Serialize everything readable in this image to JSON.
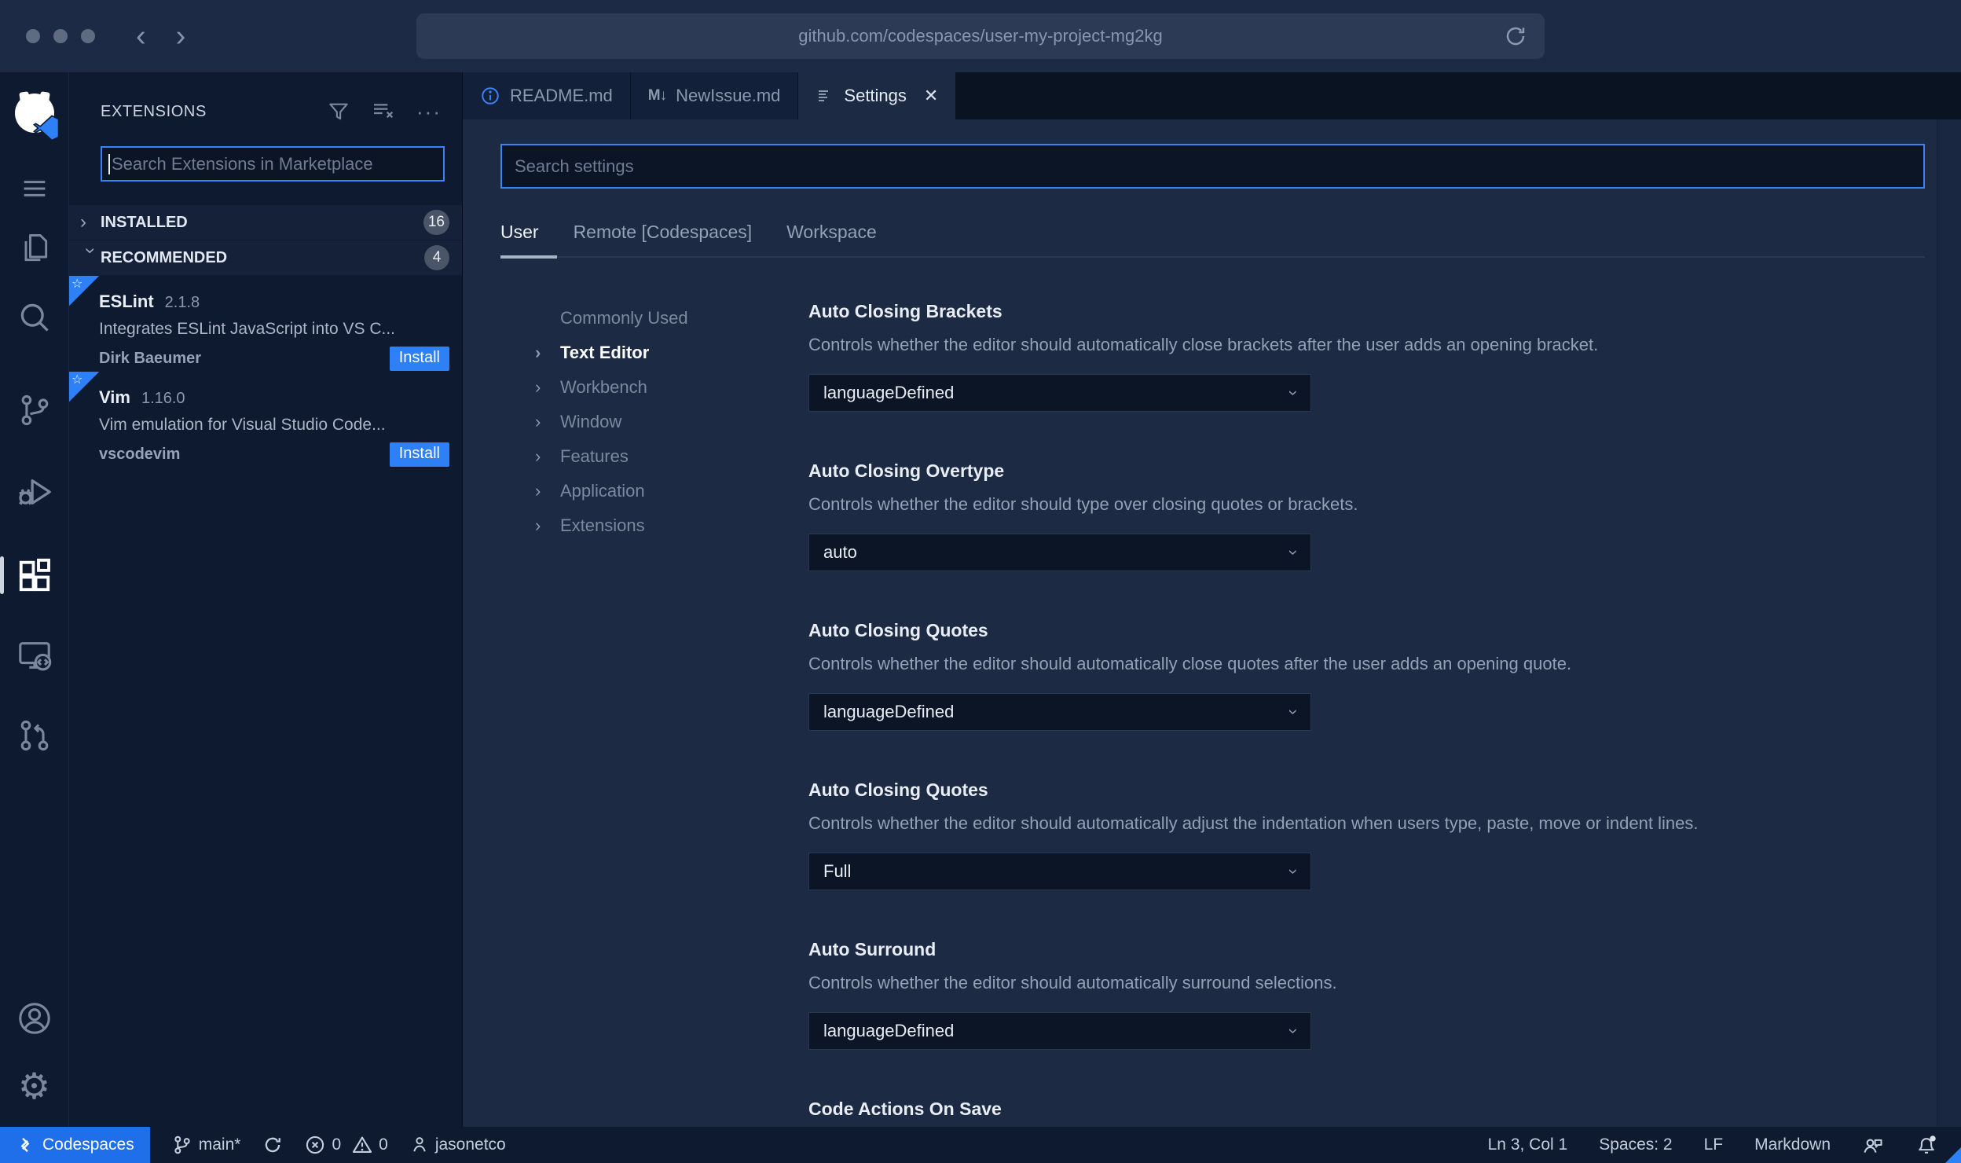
{
  "browser": {
    "url": "github.com/codespaces/user-my-project-mg2kg",
    "back_icon": "‹",
    "forward_icon": "›"
  },
  "icons": {
    "chevron": "›",
    "ellipsis": "···",
    "close": "✕",
    "md_icon": "M↓",
    "star": "☆",
    "gear": "⚙"
  },
  "sidebar": {
    "title": "EXTENSIONS",
    "search_placeholder": "Search Extensions in Marketplace",
    "sections": [
      {
        "label": "INSTALLED",
        "count": "16"
      },
      {
        "label": "RECOMMENDED",
        "count": "4"
      }
    ],
    "extensions": [
      {
        "name": "ESLint",
        "version": "2.1.8",
        "description": "Integrates ESLint JavaScript into VS C...",
        "author": "Dirk Baeumer",
        "action": "Install"
      },
      {
        "name": "Vim",
        "version": "1.16.0",
        "description": "Vim emulation for Visual Studio Code...",
        "author": "vscodevim",
        "action": "Install"
      }
    ]
  },
  "editor": {
    "tabs": [
      {
        "label": "README.md"
      },
      {
        "label": "NewIssue.md"
      },
      {
        "label": "Settings"
      }
    ],
    "settings": {
      "search_placeholder": "Search settings",
      "scopes": [
        "User",
        "Remote [Codespaces]",
        "Workspace"
      ],
      "toc": [
        "Commonly Used",
        "Text Editor",
        "Workbench",
        "Window",
        "Features",
        "Application",
        "Extensions"
      ],
      "items": [
        {
          "title": "Auto Closing Brackets",
          "description": "Controls whether the editor should automatically close brackets after the user adds an opening bracket.",
          "value": "languageDefined"
        },
        {
          "title": "Auto Closing Overtype",
          "description": "Controls whether the editor should type over closing quotes or brackets.",
          "value": "auto"
        },
        {
          "title": "Auto Closing Quotes",
          "description": "Controls whether the editor should automatically close quotes after the user adds an opening quote.",
          "value": "languageDefined"
        },
        {
          "title": "Auto Closing Quotes",
          "description": "Controls whether the editor should automatically adjust the indentation when users type, paste, move or indent lines.",
          "value": "Full"
        },
        {
          "title": "Auto Surround",
          "description": "Controls whether the editor should automatically surround selections.",
          "value": "languageDefined"
        },
        {
          "title": "Code Actions On Save",
          "description": "",
          "value": ""
        }
      ]
    }
  },
  "status_bar": {
    "codespaces_label": "Codespaces",
    "branch_label": "main*",
    "error_count": "0",
    "warning_count": "0",
    "user_label": "jasonetco",
    "line_col": "Ln 3, Col 1",
    "indent": "Spaces: 2",
    "eol": "LF",
    "language": "Markdown"
  },
  "colors": {
    "accent_blue": "#2e80f7",
    "status_blue": "#1f6feb",
    "focus_border": "#3b82f6",
    "chrome_bg": "#1c2a45",
    "editor_bg": "#1d2a44",
    "panel_bg": "#0e1a30",
    "tabbar_bg": "#0a1322",
    "inactive_tab_bg": "#13203a",
    "statusbar_bg": "#0d1a30",
    "input_bg": "#0c1526",
    "text_primary": "#e8edf4",
    "text_secondary": "#8b99ad"
  }
}
